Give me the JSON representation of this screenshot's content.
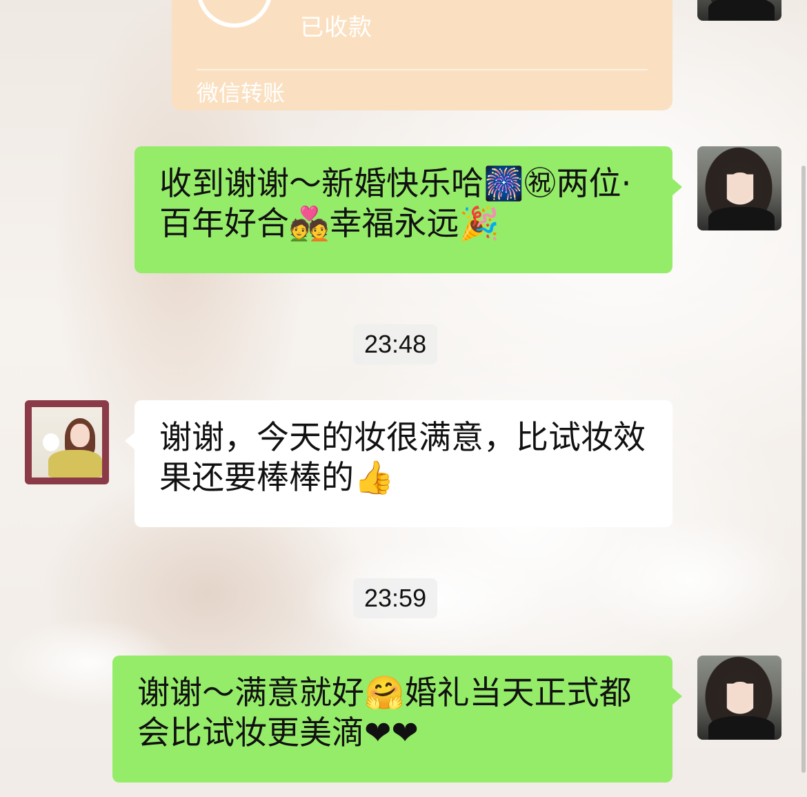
{
  "transfer": {
    "status": "已收款",
    "footer": "微信转账"
  },
  "messages": [
    {
      "from": "me",
      "text": "收到谢谢～新婚快乐哈🎆㊗两位·百年好合💑幸福永远🎉"
    },
    {
      "from": "other",
      "text": "谢谢，今天的妆很满意，比试妆效果还要棒棒的👍"
    },
    {
      "from": "me",
      "text": "谢谢～满意就好🤗婚礼当天正式都会比试妆更美滴❤❤"
    }
  ],
  "times": [
    "23:48",
    "23:59"
  ],
  "colors": {
    "sent_bubble": "#95ec69",
    "received_bubble": "#ffffff",
    "transfer_card": "#fae0c0"
  }
}
